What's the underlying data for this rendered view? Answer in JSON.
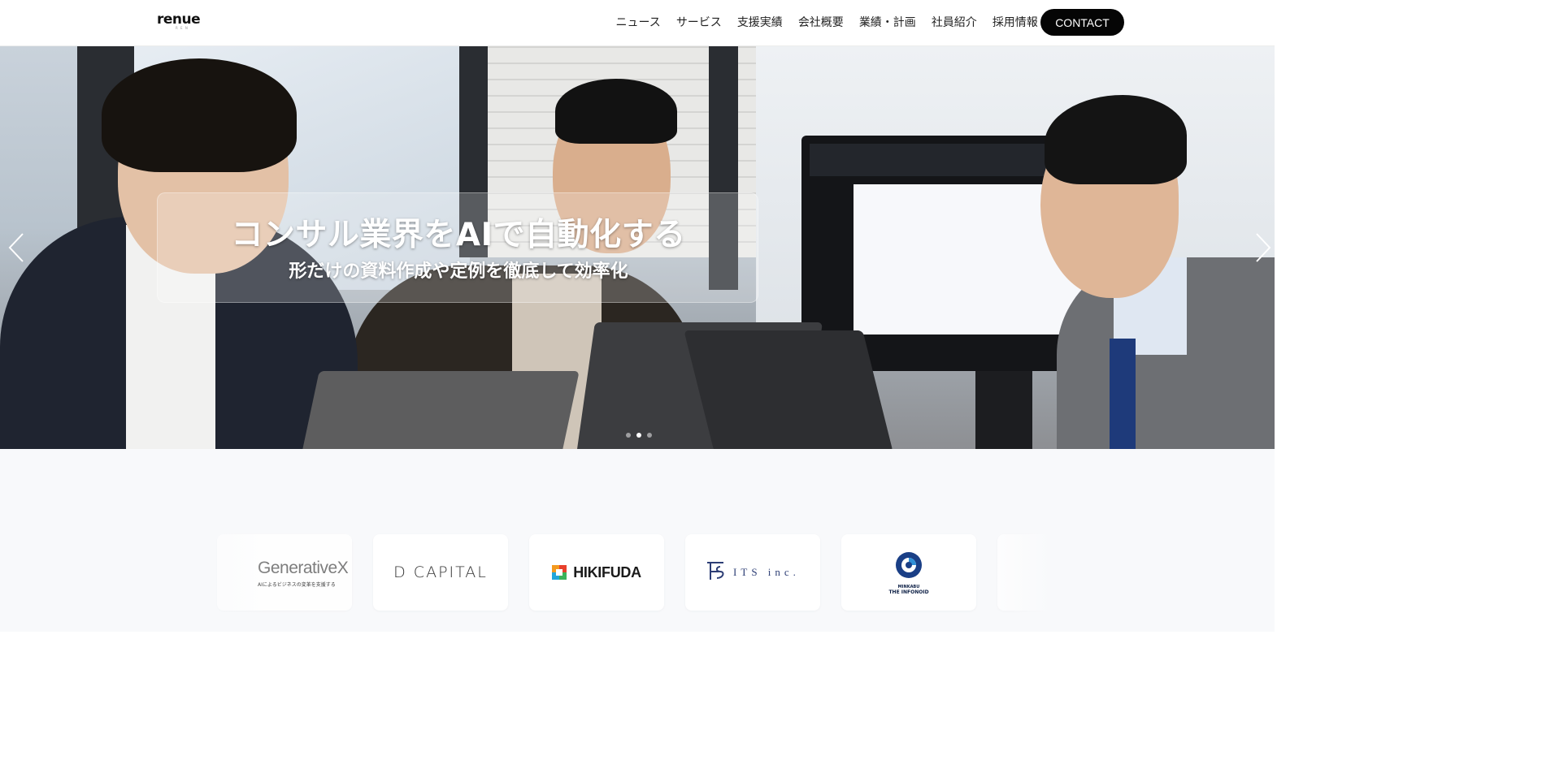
{
  "header": {
    "logo_text": "renue",
    "logo_sub": "R E N",
    "nav": [
      {
        "label": "ニュース"
      },
      {
        "label": "サービス"
      },
      {
        "label": "支援実績"
      },
      {
        "label": "会社概要"
      },
      {
        "label": "業績・計画"
      },
      {
        "label": "社員紹介"
      },
      {
        "label": "採用情報"
      }
    ],
    "contact_label": "CONTACT"
  },
  "hero": {
    "title": "コンサル業界をAIで自動化する",
    "subtitle": "形だけの資料作成や定例を徹底して効率化",
    "slides": 3,
    "active_slide": 2
  },
  "logos": {
    "items": [
      {
        "name": "GenerativeX",
        "tagline": "AIによるビジネスの変革を支援する"
      },
      {
        "name": "D CAPITAL"
      },
      {
        "name": "HIKIFUDA"
      },
      {
        "name": "ITS inc."
      },
      {
        "name": "MINKABU",
        "tagline": "THE INFONOID"
      }
    ]
  },
  "colors": {
    "contact_bg": "#050505",
    "its_blue": "#2d3e75",
    "minkabu_navy": "#0c1f45"
  }
}
